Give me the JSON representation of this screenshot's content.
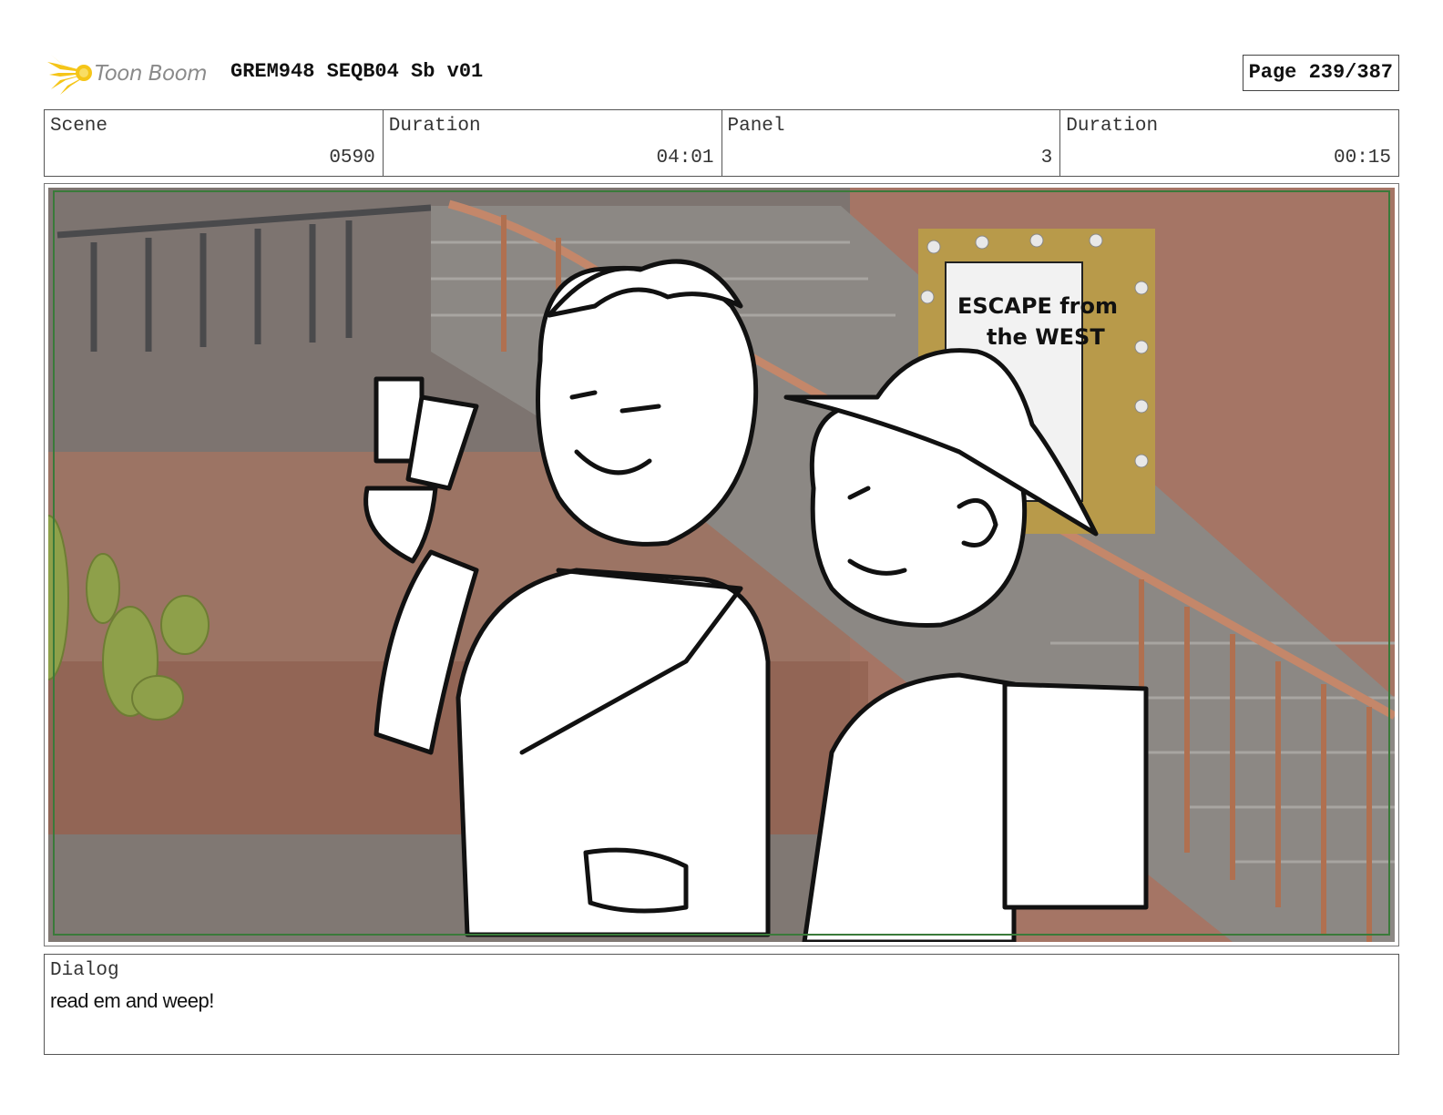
{
  "header": {
    "logo_text": "Toon Boom",
    "project_title": "GREM948 SEQB04 Sb v01",
    "page_label": "Page 239/387"
  },
  "info": {
    "scene_label": "Scene",
    "scene_value": "0590",
    "scene_duration_label": "Duration",
    "scene_duration_value": "04:01",
    "panel_label": "Panel",
    "panel_value": "3",
    "panel_duration_label": "Duration",
    "panel_duration_value": "00:15"
  },
  "panel": {
    "poster_line1": "ESCAPE from",
    "poster_line2": "the WEST"
  },
  "dialog": {
    "label": "Dialog",
    "text": "read em and weep!"
  },
  "colors": {
    "safe_frame": "#3a7a3a",
    "wall": "#9a6e5c",
    "stair": "#8d8a86",
    "cactus": "#8ea04a",
    "logo_yellow": "#f5c518"
  }
}
